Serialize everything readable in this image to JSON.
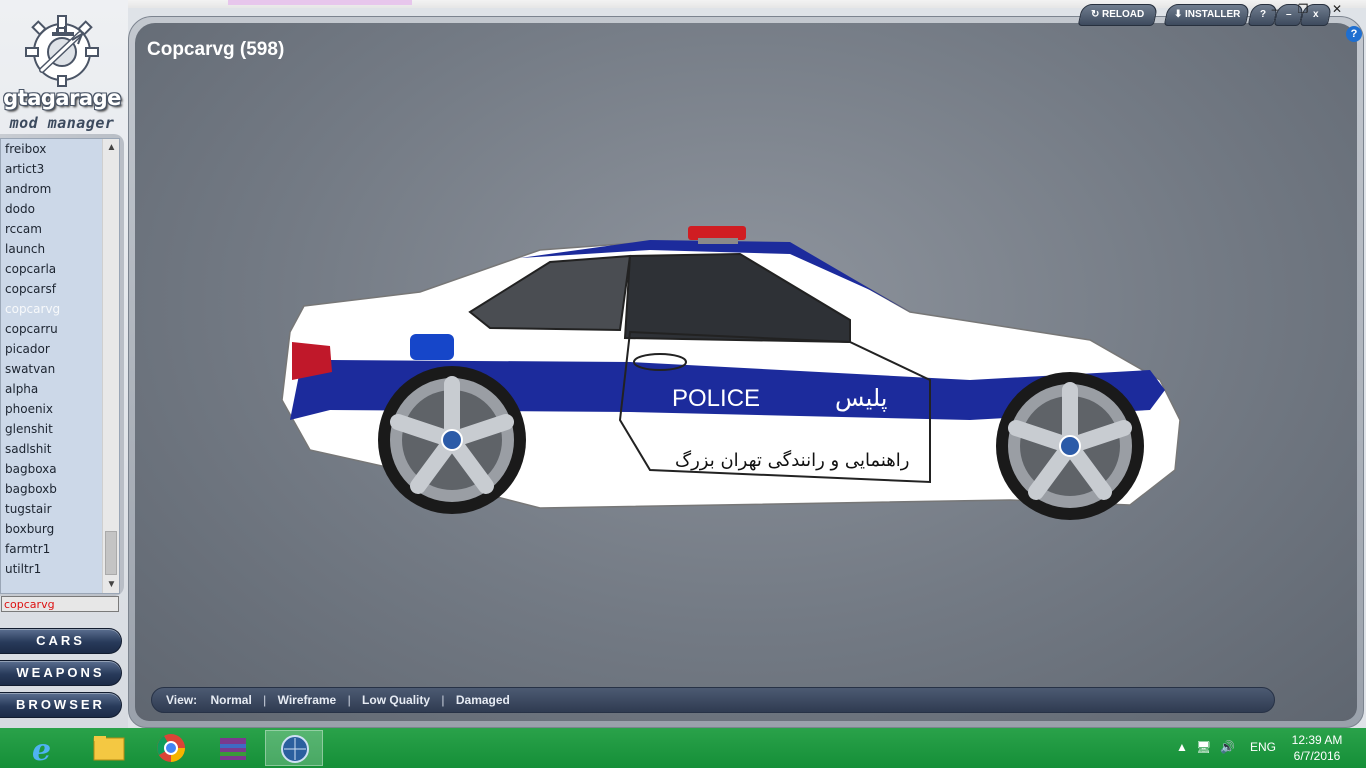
{
  "app": {
    "logo_title": "gtagarage",
    "logo_subtitle": "mod manager"
  },
  "sidebar": {
    "items": [
      {
        "label": "freibox"
      },
      {
        "label": "artict3"
      },
      {
        "label": "androm"
      },
      {
        "label": "dodo"
      },
      {
        "label": "rccam"
      },
      {
        "label": "launch"
      },
      {
        "label": "copcarla"
      },
      {
        "label": "copcarsf"
      },
      {
        "label": "copcarvg",
        "selected": true
      },
      {
        "label": "copcarru"
      },
      {
        "label": "picador"
      },
      {
        "label": "swatvan"
      },
      {
        "label": "alpha"
      },
      {
        "label": "phoenix"
      },
      {
        "label": "glenshit"
      },
      {
        "label": "sadlshit"
      },
      {
        "label": "bagboxa"
      },
      {
        "label": "bagboxb"
      },
      {
        "label": "tugstair"
      },
      {
        "label": "boxburg"
      },
      {
        "label": "farmtr1"
      },
      {
        "label": "utiltr1"
      }
    ],
    "search_value": "copcarvg",
    "nav": {
      "cars": "CARS",
      "weapons": "WEAPONS",
      "browser": "BROWSER"
    }
  },
  "main": {
    "title": "Copcarvg (598)",
    "view_bar": {
      "label": "View:",
      "options": [
        "Normal",
        "Wireframe",
        "Low Quality",
        "Damaged"
      ]
    }
  },
  "car_livery": {
    "police_en": "POLICE",
    "police_fa": "پلیس",
    "subtitle_fa": "راهنمایی و رانندگی تهران بزرگ"
  },
  "controls": {
    "reload": "RELOAD",
    "installer": "INSTALLER",
    "help": "?",
    "minimize": "–",
    "close": "x"
  },
  "taskbar": {
    "language": "ENG",
    "time": "12:39 AM",
    "date": "6/7/2016"
  },
  "colors": {
    "accent_blue": "#1c2b9c",
    "nav_button": "#283a5a",
    "taskbar": "#1d9a40"
  }
}
